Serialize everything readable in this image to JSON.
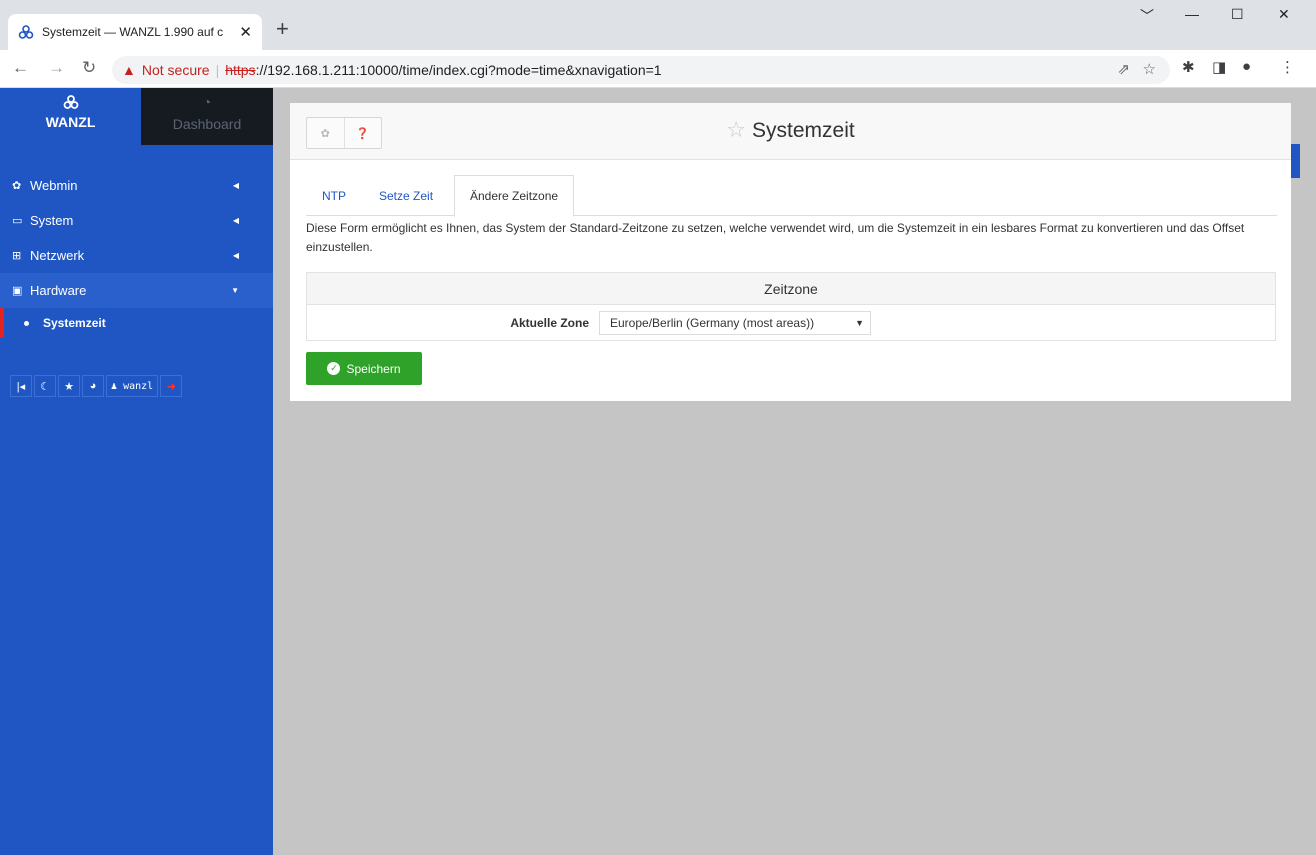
{
  "browser": {
    "tab_title": "Systemzeit — WANZL 1.990 auf c",
    "close_glyph": "✕",
    "new_tab_glyph": "+",
    "window_controls": [
      "﹀",
      "—",
      "☐",
      "✕"
    ],
    "not_secure_label": "Not secure",
    "url_scheme": "https",
    "url_rest": "://192.168.1.211:10000/time/index.cgi?mode=time&xnavigation=1"
  },
  "sidebar": {
    "brand": "WANZL",
    "dashboard": "Dashboard",
    "menu": [
      {
        "label": "Webmin",
        "icon": "gear-icon"
      },
      {
        "label": "System",
        "icon": "laptop-icon"
      },
      {
        "label": "Netzwerk",
        "icon": "sitemap-icon"
      },
      {
        "label": "Hardware",
        "icon": "hdd-icon"
      }
    ],
    "sub_item": "Systemzeit",
    "quickbar_user": "wanzl"
  },
  "header": {
    "title": "Systemzeit"
  },
  "tabs": [
    "NTP",
    "Setze Zeit",
    "Ändere Zeitzone"
  ],
  "active_tab": "Ändere Zeitzone",
  "description": "Diese Form ermöglicht es Ihnen, das System der Standard-Zeitzone zu setzen, welche verwendet wird, um die Systemzeit in ein lesbares Format zu konvertieren und das Offset einzustellen.",
  "form": {
    "section_title": "Zeitzone",
    "zone_label": "Aktuelle Zone",
    "zone_value": "Europe/Berlin (Germany (most areas))"
  },
  "save_button": "Speichern",
  "colors": {
    "sidebar": "#2056c3",
    "save": "#2fa229",
    "dashboard_bg": "#161b22",
    "active_marker": "#e52222"
  }
}
